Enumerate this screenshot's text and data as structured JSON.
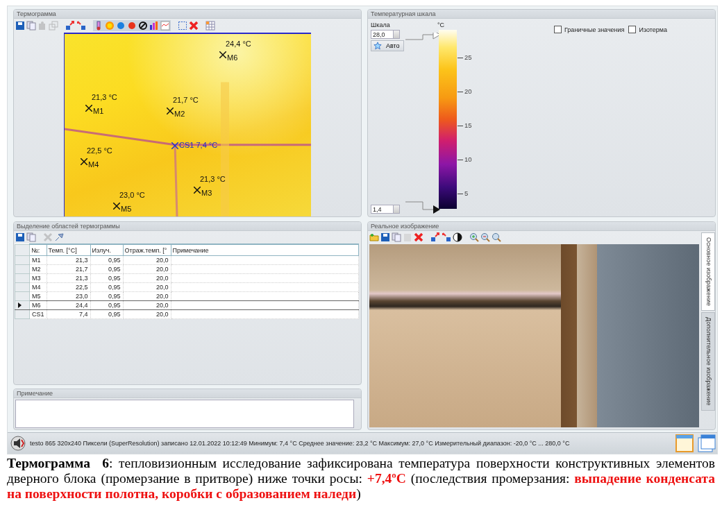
{
  "thermogram_panel": {
    "title": "Термограмма",
    "markers": [
      {
        "label": "M6",
        "reading": "24,4 °C",
        "kind": "point"
      },
      {
        "label": "M1",
        "reading": "21,3 °C",
        "kind": "point"
      },
      {
        "label": "M2",
        "reading": "21,7 °C",
        "kind": "point"
      },
      {
        "label": "M4",
        "reading": "22,5 °C",
        "kind": "point"
      },
      {
        "label": "M3",
        "reading": "21,3 °C",
        "kind": "point"
      },
      {
        "label": "M5",
        "reading": "23,0 °C",
        "kind": "point"
      },
      {
        "label": "CS1 7,4 °C",
        "kind": "coldspot"
      }
    ]
  },
  "scale_panel": {
    "title": "Температурная шкала",
    "scale_label": "Шкала",
    "max_value": "28,0",
    "min_value": "1,4",
    "auto_button": "Авто",
    "unit": "°C",
    "ticks": [
      "25",
      "20",
      "15",
      "10",
      "5"
    ],
    "checkboxes": [
      {
        "label": "Граничные значения",
        "checked": false
      },
      {
        "label": "Изотерма",
        "checked": false
      }
    ]
  },
  "regions_panel": {
    "title": "Выделение областей термограммы",
    "columns": [
      "№:",
      "Темп. [°C]",
      "Излуч.",
      "Отраж.темп. [°",
      "Примечание"
    ],
    "rows": [
      {
        "cells": [
          "M1",
          "21,3",
          "0,95",
          "20,0"
        ],
        "selected": false
      },
      {
        "cells": [
          "M2",
          "21,7",
          "0,95",
          "20,0"
        ],
        "selected": false
      },
      {
        "cells": [
          "M3",
          "21,3",
          "0,95",
          "20,0"
        ],
        "selected": false
      },
      {
        "cells": [
          "M4",
          "22,5",
          "0,95",
          "20,0"
        ],
        "selected": false
      },
      {
        "cells": [
          "M5",
          "23,0",
          "0,95",
          "20,0"
        ],
        "selected": false
      },
      {
        "cells": [
          "M6",
          "24,4",
          "0,95",
          "20,0"
        ],
        "selected": true
      },
      {
        "cells": [
          "CS1",
          "7,4",
          "0,95",
          "20,0"
        ],
        "selected": false
      }
    ]
  },
  "note_panel": {
    "title": "Примечание"
  },
  "real_image_panel": {
    "title": "Реальное изображение",
    "tabs": [
      {
        "label": "Основное изображение",
        "selected": true
      },
      {
        "label": "Дополнительное изображение",
        "selected": false
      }
    ]
  },
  "status_bar": {
    "text": "testo 865 320x240 Пиксели (SuperResolution) записано 12.01.2022 10:12:49 Минимум: 7,4 °C Среднее значение: 23,2 °C Максимум: 27,0 °C Измерительный диапазон: -20,0 °C ... 280,0 °C"
  },
  "caption": [
    {
      "kind": "bold",
      "text": "Термограмма  6"
    },
    {
      "kind": "plain",
      "text": ": тепловизионным исследование зафиксирована температура поверхности конструктивных элементов дверного блока (промерзание в притворе) ниже точки росы: "
    },
    {
      "kind": "alert",
      "text": "+7,4ºC"
    },
    {
      "kind": "plain",
      "text": " (последствия промерзания: "
    },
    {
      "kind": "alert",
      "text": "выпадение конденсата на поверхности полотна, коробки с образованием наледи"
    },
    {
      "kind": "plain",
      "text": ")"
    }
  ]
}
